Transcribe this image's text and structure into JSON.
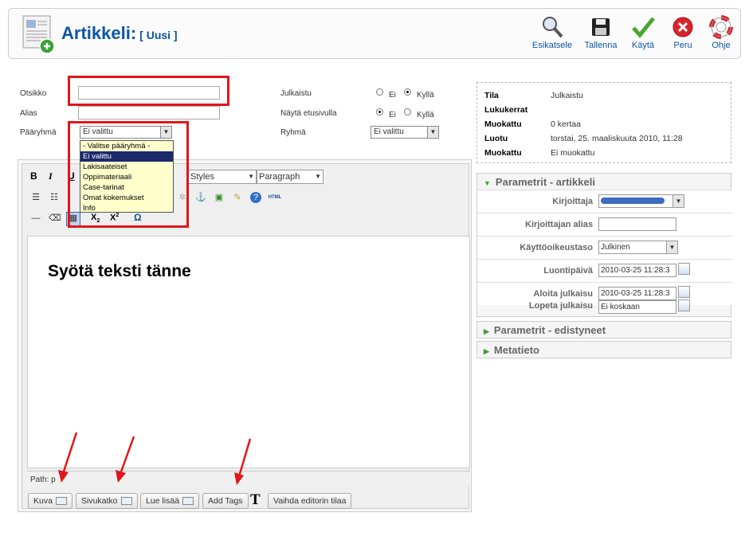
{
  "header": {
    "title": "Artikkeli:",
    "subtitle": "[ Uusi ]",
    "buttons": [
      {
        "label": "Esikatsele",
        "icon": "magnifier-icon"
      },
      {
        "label": "Tallenna",
        "icon": "floppy-disk-icon"
      },
      {
        "label": "Käytä",
        "icon": "checkmark-icon"
      },
      {
        "label": "Peru",
        "icon": "cancel-icon"
      },
      {
        "label": "Ohje",
        "icon": "lifebuoy-icon"
      }
    ]
  },
  "form": {
    "otsikko_label": "Otsikko",
    "otsikko_value": "",
    "alias_label": "Alias",
    "alias_value": "",
    "paaryhma_label": "Pääryhmä",
    "paaryhma_value": "Ei valittu",
    "julkaistu_label": "Julkaistu",
    "julkaistu_ei": "Ei",
    "julkaistu_kylla": "Kyllä",
    "etusivu_label": "Näytä etusivulla",
    "etusivu_ei": "Ei",
    "etusivu_kylla": "Kyllä",
    "ryhma_label": "Ryhmä",
    "ryhma_value": "Ei valittu"
  },
  "dropdown": {
    "options": [
      "- Valitse pääryhmä -",
      "Ei valittu",
      "Lakisaateiset",
      "Oppimateriaali",
      "Case-tarinat",
      "Omat kokemukset",
      "Info"
    ],
    "selected_index": 1
  },
  "editor": {
    "styles_label": "Styles",
    "format_label": "Paragraph",
    "content_text": "Syötä teksti tänne",
    "path_text": "Path: p",
    "bold": "B",
    "italic": "I",
    "underline": "U",
    "subscript": "X",
    "superscript": "X",
    "omega": "Ω",
    "html_label": "HTML"
  },
  "bottom_buttons": [
    "Kuva",
    "Sivukatko",
    "Lue lisää",
    "Add Tags",
    "Vaihda editorin tilaa"
  ],
  "add_tags_icon_letter": "T",
  "info": {
    "rows": [
      {
        "key": "Tila",
        "value": "Julkaistu"
      },
      {
        "key": "Lukukerrat",
        "value": ""
      },
      {
        "key": "Muokattu",
        "value": "0 kertaa"
      },
      {
        "key": "Luotu",
        "value": "torstai, 25. maaliskuuta 2010, 11:28"
      },
      {
        "key": "Muokattu",
        "value": "Ei muokattu"
      }
    ]
  },
  "params_article": {
    "title": "Parametrit - artikkeli",
    "rows": [
      {
        "label": "Kirjoittaja",
        "value": ""
      },
      {
        "label": "Kirjoittajan alias",
        "value": ""
      },
      {
        "label": "Käyttöoikeustaso",
        "value": "Julkinen"
      },
      {
        "label": "Luontipäivä",
        "value": "2010-03-25 11:28:3"
      },
      {
        "label": "Aloita julkaisu",
        "value": "2010-03-25 11:28:3"
      },
      {
        "label": "Lopeta julkaisu",
        "value": "Ei koskaan"
      }
    ]
  },
  "params_advanced": {
    "title": "Parametrit - edistyneet"
  },
  "metadata": {
    "title": "Metatieto"
  },
  "colors": {
    "brand": "#0b55a6",
    "highlight": "#e0161a",
    "dropdown_bg": "#ffffcc"
  }
}
